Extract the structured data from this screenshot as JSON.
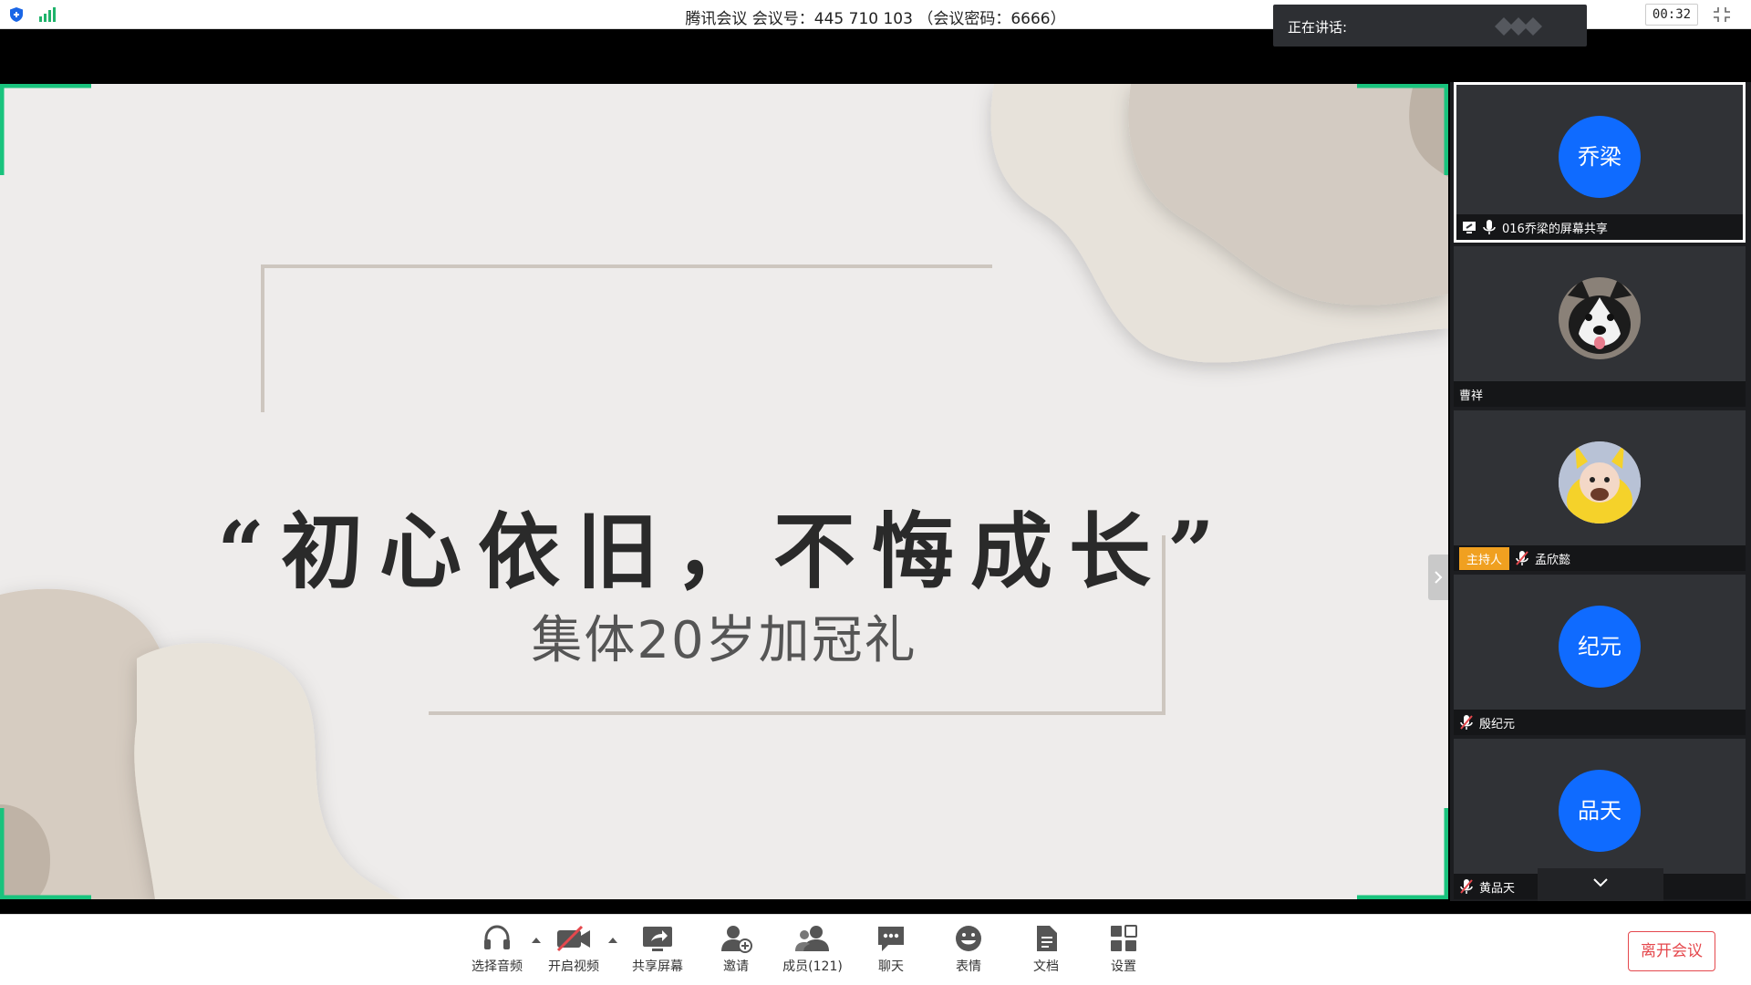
{
  "titlebar": {
    "title": "腾讯会议 会议号：445 710 103 （会议密码：6666）",
    "speaking_label": "正在讲话:",
    "timer": "00:32"
  },
  "slide": {
    "quote": "“初心依旧，不悔成长”",
    "subtitle": "集体20岁加冠礼"
  },
  "participants": [
    {
      "avatar_text": "乔梁",
      "name": "016乔梁的屏幕共享",
      "active": true,
      "icons": [
        "screen-share-icon",
        "mic-icon"
      ]
    },
    {
      "avatar_text": "",
      "avatar_type": "husky-photo",
      "name": "曹祥"
    },
    {
      "avatar_text": "",
      "avatar_type": "child-photo",
      "name": "孟欣懿",
      "role": "主持人",
      "muted": true
    },
    {
      "avatar_text": "纪元",
      "name": "殷纪元",
      "muted": true
    },
    {
      "avatar_text": "品天",
      "name": "黄品天",
      "muted": true
    }
  ],
  "toolbar": {
    "items": [
      {
        "label": "选择音频",
        "icon": "headset-icon"
      },
      {
        "label": "开启视频",
        "icon": "video-off-icon"
      },
      {
        "label": "共享屏幕",
        "icon": "share-screen-icon"
      },
      {
        "label": "邀请",
        "icon": "invite-icon"
      },
      {
        "label": "成员(121)",
        "icon": "members-icon"
      },
      {
        "label": "聊天",
        "icon": "chat-icon"
      },
      {
        "label": "表情",
        "icon": "emoji-icon"
      },
      {
        "label": "文档",
        "icon": "document-icon"
      },
      {
        "label": "设置",
        "icon": "settings-icon"
      }
    ],
    "leave_label": "离开会议"
  },
  "colors": {
    "accent_blue": "#0f6bff",
    "corner_green": "#19c37d",
    "leave_red": "#e5484d",
    "host_orange": "#f0a020"
  }
}
